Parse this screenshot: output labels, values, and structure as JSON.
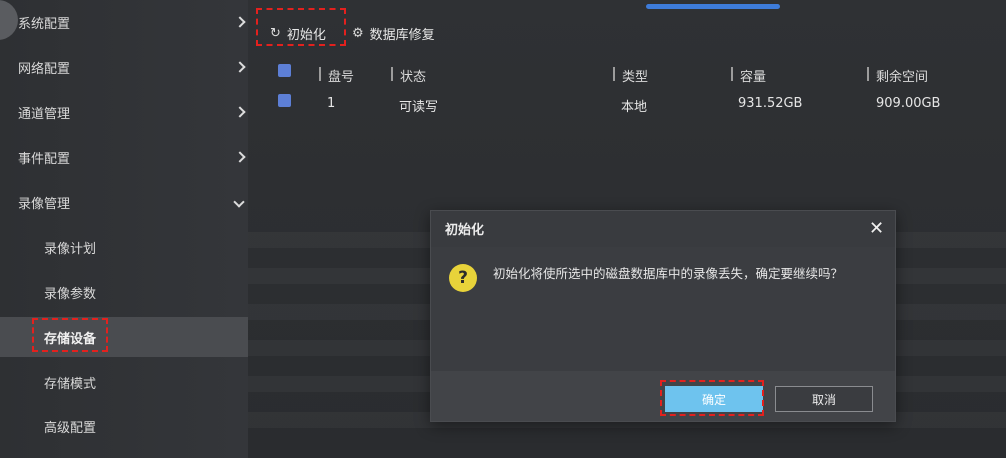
{
  "sidebar": {
    "items": [
      {
        "label": "系统配置"
      },
      {
        "label": "网络配置"
      },
      {
        "label": "通道管理"
      },
      {
        "label": "事件配置"
      },
      {
        "label": "录像管理"
      }
    ],
    "sub_items": [
      {
        "label": "录像计划"
      },
      {
        "label": "录像参数"
      },
      {
        "label": "存储设备",
        "active": true
      },
      {
        "label": "存储模式"
      },
      {
        "label": "高级配置"
      }
    ]
  },
  "toolbar": {
    "init_label": "初始化",
    "repair_label": "数据库修复",
    "init_icon": "refresh-icon",
    "repair_icon": "gear-icon"
  },
  "table": {
    "columns": [
      "盘号",
      "状态",
      "类型",
      "容量",
      "剩余空间"
    ],
    "rows": [
      {
        "disk": "1",
        "status": "可读写",
        "type": "本地",
        "capacity": "931.52GB",
        "free": "909.00GB"
      }
    ]
  },
  "dialog": {
    "title": "初始化",
    "close_symbol": "✕",
    "icon_symbol": "?",
    "message": "初始化将使所选中的磁盘数据库中的录像丢失，确定要继续吗？",
    "ok_label": "确定",
    "cancel_label": "取消"
  },
  "colors": {
    "accent": "#3d7bd9",
    "ok_button": "#6ec3ee",
    "warning": "#e8d33a",
    "annotation": "#e3211e"
  }
}
